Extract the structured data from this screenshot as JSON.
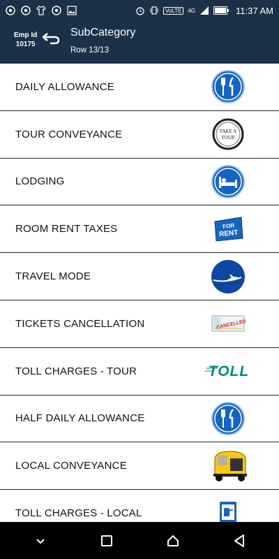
{
  "status_bar": {
    "network": "VoLTE",
    "signal": "4G",
    "time": "11:37 AM"
  },
  "header": {
    "emp_label": "Emp Id",
    "emp_id": "10175",
    "title": "SubCategory",
    "subtitle": "Row 13/13"
  },
  "rows": [
    {
      "label": "DAILY ALLOWANCE",
      "icon": "fork-knife-icon"
    },
    {
      "label": "TOUR  CONVEYANCE",
      "icon": "take-a-tour-icon",
      "icon_text": "TAKE A TOUR"
    },
    {
      "label": "LODGING",
      "icon": "bed-icon"
    },
    {
      "label": "ROOM RENT TAXES",
      "icon": "for-rent-sign-icon",
      "icon_text": "FOR RENT"
    },
    {
      "label": "TRAVEL MODE",
      "icon": "airplane-icon"
    },
    {
      "label": "TICKETS CANCELLATION",
      "icon": "cancelled-ticket-icon",
      "icon_text": "CANCELLED"
    },
    {
      "label": "TOLL CHARGES - TOUR",
      "icon": "toll-logo-icon",
      "icon_text": "TOLL"
    },
    {
      "label": "HALF DAILY ALLOWANCE",
      "icon": "fork-knife-icon"
    },
    {
      "label": "LOCAL CONVEYANCE",
      "icon": "auto-rickshaw-icon"
    },
    {
      "label": "TOLL CHARGES - LOCAL",
      "icon": "toll-booth-icon"
    }
  ],
  "colors": {
    "header_bg": "#1c3148",
    "icon_blue": "#1565c0"
  }
}
